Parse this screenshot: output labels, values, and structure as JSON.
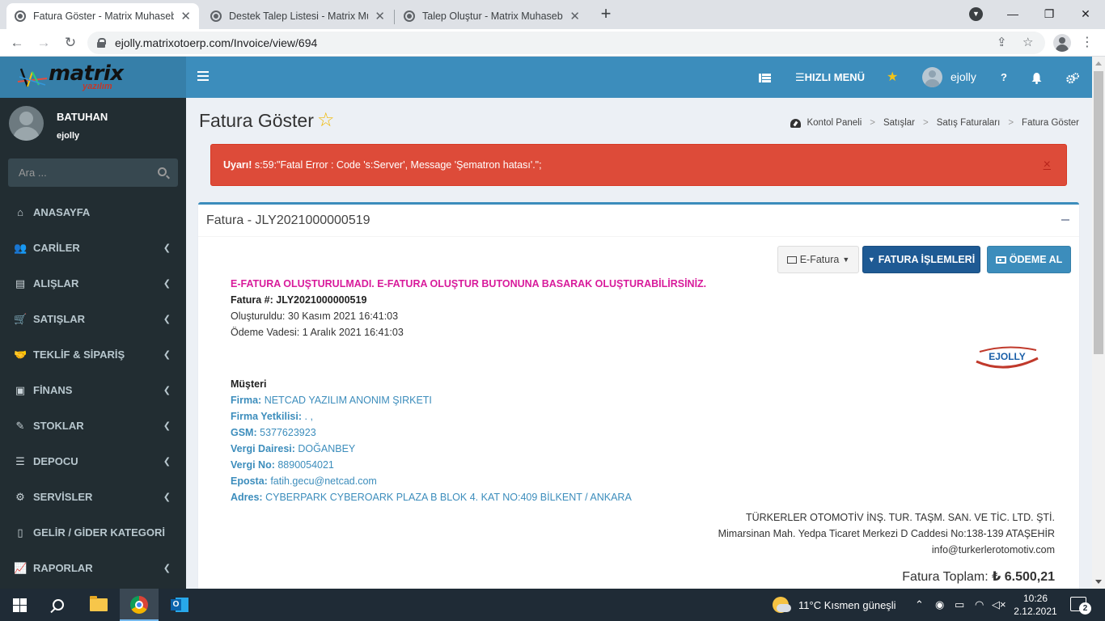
{
  "browser": {
    "tabs": [
      {
        "title": "Fatura Göster - Matrix Muhasebe",
        "active": true
      },
      {
        "title": "Destek Talep Listesi - Matrix Muh",
        "active": false
      },
      {
        "title": "Talep Oluştur - Matrix Muhasebe",
        "active": false
      }
    ],
    "url": "ejolly.matrixotoerp.com/Invoice/view/694"
  },
  "app": {
    "logo": {
      "name": "matrix",
      "sub": "yazılım"
    },
    "topnav": {
      "quick_menu": "HIZLI MENÜ",
      "username": "ejolly",
      "help": "?"
    },
    "user_panel": {
      "name": "BATUHAN",
      "login": "ejolly"
    },
    "search": {
      "placeholder": "Ara ..."
    },
    "menu": [
      {
        "label": "ANASAYFA",
        "icon": "home-icon",
        "has_children": false
      },
      {
        "label": "CARİLER",
        "icon": "users-icon",
        "has_children": true
      },
      {
        "label": "ALIŞLAR",
        "icon": "card-icon",
        "has_children": true
      },
      {
        "label": "SATIŞLAR",
        "icon": "cart-icon",
        "has_children": true
      },
      {
        "label": "TEKLİF & SİPARİŞ",
        "icon": "handshake-icon",
        "has_children": true
      },
      {
        "label": "FİNANS",
        "icon": "money-icon",
        "has_children": true
      },
      {
        "label": "STOKLAR",
        "icon": "edit-icon",
        "has_children": true
      },
      {
        "label": "DEPOCU",
        "icon": "database-icon",
        "has_children": true
      },
      {
        "label": "SERVİSLER",
        "icon": "cogs-icon",
        "has_children": true
      },
      {
        "label": "GELİR / GİDER KATEGORİ",
        "icon": "file-icon",
        "has_children": false
      },
      {
        "label": "RAPORLAR",
        "icon": "chart-icon",
        "has_children": true
      }
    ],
    "page": {
      "title": "Fatura Göster",
      "breadcrumb": [
        "Kontol Paneli",
        "Satışlar",
        "Satış Faturaları",
        "Fatura Göster"
      ]
    },
    "alert": {
      "label": "Uyarı!",
      "message": "s:59:\"Fatal Error : Code 's:Server', Message 'Şematron hatası'.\";",
      "close": "×"
    },
    "box": {
      "title": "Fatura - JLY2021000000519",
      "buttons": {
        "efatura": "E-Fatura",
        "islemler": "FATURA İŞLEMLERİ",
        "odeme": "ÖDEME AL"
      }
    },
    "invoice": {
      "warning": "E-FATURA OLUŞTURULMADI. E-FATURA OLUŞTUR BUTONUNA BASARAK OLUŞTURABİLİRSİNİZ.",
      "number": "Fatura #: JLY2021000000519",
      "created": "Oluşturuldu: 30 Kasım 2021 16:41:03",
      "due": "Ödeme Vadesi: 1 Aralık 2021 16:41:03",
      "logo_text": "EJOLLY",
      "customer_title": "Müşteri",
      "customer": [
        {
          "label": "Firma:",
          "value": "NETCAD YAZILIM ANONIM ŞIRKETI"
        },
        {
          "label": "Firma Yetkilisi:",
          "value": ". ,"
        },
        {
          "label": "GSM:",
          "value": "5377623923"
        },
        {
          "label": "Vergi Dairesi:",
          "value": "DOĞANBEY"
        },
        {
          "label": "Vergi No:",
          "value": "8890054021"
        },
        {
          "label": "Eposta:",
          "value": "fatih.gecu@netcad.com"
        },
        {
          "label": "Adres:",
          "value": "CYBERPARK CYBEROARK PLAZA B BLOK 4. KAT NO:409 BİLKENT / ANKARA"
        }
      ],
      "seller": [
        "TÜRKERLER OTOMOTİV İNŞ. TUR. TAŞM. SAN. VE TİC. LTD. ŞTİ.",
        "Mimarsinan Mah. Yedpa Ticaret Merkezi D Caddesi No:138-139 ATAŞEHİR",
        "info@turkerlerotomotiv.com"
      ],
      "total_label": "Fatura Toplam:",
      "total_value": "₺ 6.500,21"
    }
  },
  "taskbar": {
    "weather": "11°C  Kısmen güneşli",
    "time": "10:26",
    "date": "2.12.2021",
    "notifications": "2"
  },
  "colors": {
    "sidebar": "#222d32",
    "header": "#3c8dbc",
    "alert": "#dd4b39",
    "warning_text": "#d81b9b"
  }
}
